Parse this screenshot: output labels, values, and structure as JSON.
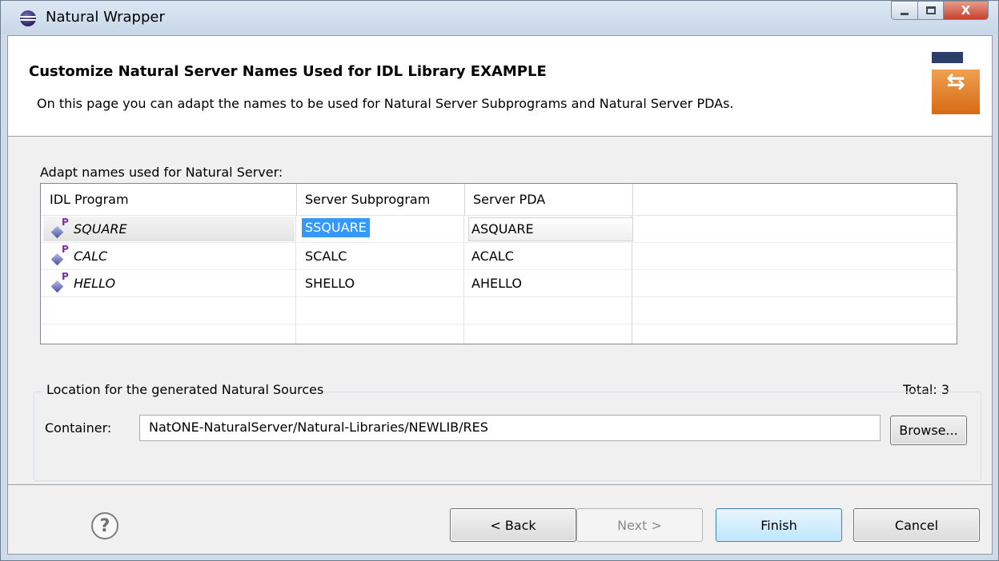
{
  "window": {
    "title": "Natural Wrapper",
    "controls": {
      "minimize": "minimize",
      "maximize": "maximize",
      "close": "X"
    }
  },
  "header": {
    "title": "Customize Natural Server Names Used for IDL Library EXAMPLE",
    "description": "On this page you can adapt the names to be used for Natural Server Subprograms and Natural Server PDAs.",
    "wizard_icon_glyph": "⇆"
  },
  "table": {
    "caption": "Adapt names used for Natural Server:",
    "columns": [
      "IDL Program",
      "Server Subprogram",
      "Server PDA"
    ],
    "icon_badge": "P",
    "rows": [
      {
        "program": "SQUARE",
        "subprogram": "SSQUARE",
        "pda": "ASQUARE"
      },
      {
        "program": "CALC",
        "subprogram": "SCALC",
        "pda": "ACALC"
      },
      {
        "program": "HELLO",
        "subprogram": "SHELLO",
        "pda": "AHELLO"
      }
    ],
    "total": "Total: 3"
  },
  "location": {
    "group_title": "Location for the generated Natural Sources",
    "container_label": "Container:",
    "container_value": "NatONE-NaturalServer/Natural-Libraries/NEWLIB/RES",
    "browse_label": "Browse..."
  },
  "footer": {
    "help_glyph": "?",
    "back_label": "< Back",
    "next_label": "Next >",
    "finish_label": "Finish",
    "cancel_label": "Cancel"
  },
  "colors": {
    "selection": "#3399ff",
    "finish_border": "#3c7fb1",
    "wizard_orange": "#e07a1f",
    "close_red": "#c6412b"
  }
}
